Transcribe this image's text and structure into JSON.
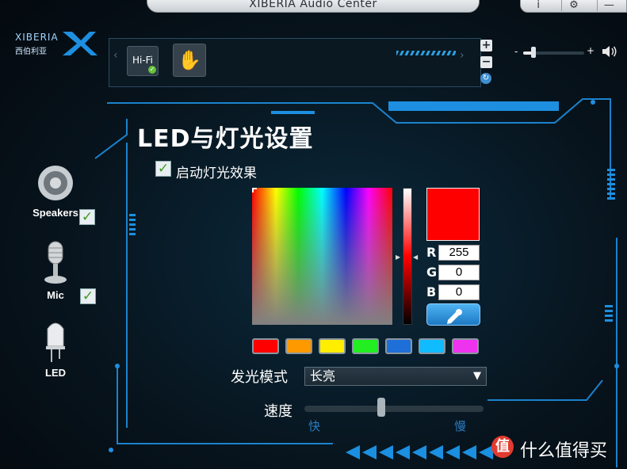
{
  "window": {
    "title": "XIBERIA Audio Center",
    "controls": [
      "i",
      "⚙",
      "—"
    ]
  },
  "logo": {
    "brand": "XIBERIA",
    "sub": "西伯利亚"
  },
  "presets": {
    "hifi_label": "Hi-Fi",
    "plus": "+",
    "minus": "−"
  },
  "volume": {
    "minus": "-",
    "plus": "+",
    "level": 0.15
  },
  "sidebar": {
    "items": [
      {
        "label": "Speakers",
        "checked": true
      },
      {
        "label": "Mic",
        "checked": true
      },
      {
        "label": "LED",
        "checked": false
      }
    ]
  },
  "led": {
    "title": "LED与灯光设置",
    "enable_label": "启动灯光效果",
    "enable_checked": true,
    "color": {
      "hex": "#ff0000",
      "r_label": "R",
      "r": "255",
      "g_label": "G",
      "g": "0",
      "b_label": "B",
      "b": "0"
    },
    "swatches": [
      "#ff0000",
      "#ff9900",
      "#ffee00",
      "#22ee22",
      "#1f6fd8",
      "#11bbff",
      "#ee33ee"
    ],
    "mode_label": "发光模式",
    "mode_value": "长亮",
    "speed_label": "速度",
    "speed_fast": "快",
    "speed_slow": "慢",
    "speed_level": 0.42
  },
  "watermark": {
    "icon": "值",
    "text": "什么值得买"
  }
}
